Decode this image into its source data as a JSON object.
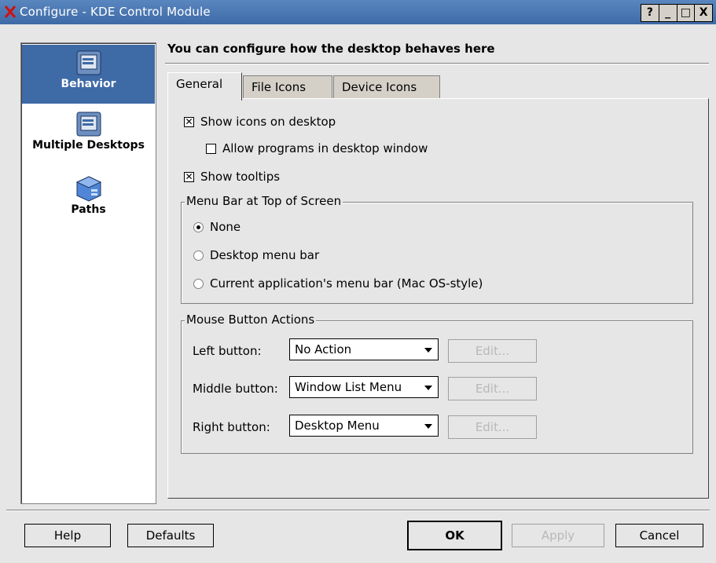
{
  "window": {
    "title": "Configure - KDE Control Module",
    "title_buttons": [
      "?",
      "_",
      "□",
      "X"
    ]
  },
  "sidebar": {
    "items": [
      {
        "label": "Behavior",
        "icon": "behavior-icon",
        "active": true
      },
      {
        "label": "Multiple Desktops",
        "icon": "multiple-desktops-icon",
        "active": false
      },
      {
        "label": "Paths",
        "icon": "paths-icon",
        "active": false
      }
    ]
  },
  "header": "You can configure how the desktop behaves here",
  "tabs": [
    "General",
    "File Icons",
    "Device Icons"
  ],
  "general": {
    "show_icons": {
      "label": "Show icons on desktop",
      "checked": true
    },
    "allow_programs": {
      "label": "Allow programs in desktop window",
      "checked": false
    },
    "show_tooltips": {
      "label": "Show tooltips",
      "checked": true
    },
    "menubar_group": {
      "title": "Menu Bar at Top of Screen",
      "options": [
        {
          "label": "None",
          "selected": true
        },
        {
          "label": "Desktop menu bar",
          "selected": false
        },
        {
          "label": "Current application's menu bar (Mac OS-style)",
          "selected": false
        }
      ]
    },
    "mouse_group": {
      "title": "Mouse Button Actions",
      "rows": [
        {
          "label": "Left button:",
          "value": "No Action",
          "edit": "Edit..."
        },
        {
          "label": "Middle button:",
          "value": "Window List Menu",
          "edit": "Edit..."
        },
        {
          "label": "Right button:",
          "value": "Desktop Menu",
          "edit": "Edit..."
        }
      ]
    }
  },
  "footer": {
    "help": "Help",
    "defaults": "Defaults",
    "ok": "OK",
    "apply": "Apply",
    "cancel": "Cancel"
  },
  "colors": {
    "titlebar": "#3e6aa6",
    "selection": "#3e6aa6",
    "background": "#e6e6e6"
  }
}
